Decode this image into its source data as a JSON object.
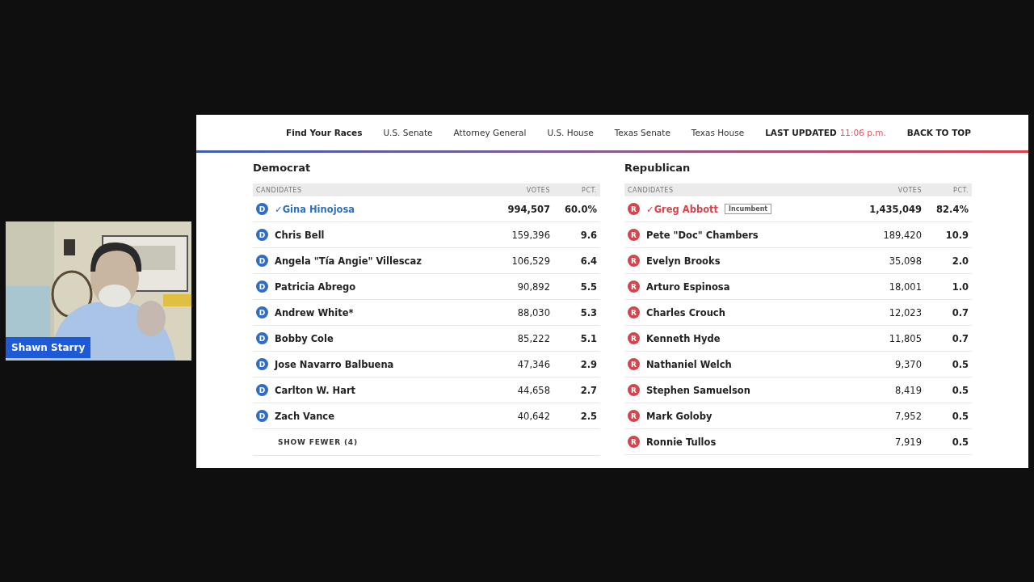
{
  "video_tile": {
    "participant": "Shawn Starry"
  },
  "shared_screen": {
    "nav": [
      {
        "kind": "bold",
        "label": "Find Your Races"
      },
      {
        "kind": "link",
        "label": "U.S. Senate"
      },
      {
        "kind": "link",
        "label": "Attorney General"
      },
      {
        "kind": "link",
        "label": "U.S. House"
      },
      {
        "kind": "link",
        "label": "Texas Senate"
      },
      {
        "kind": "link",
        "label": "Texas House"
      },
      {
        "kind": "updated",
        "label": "LAST UPDATED",
        "time": "11:06 p.m."
      },
      {
        "kind": "bold",
        "label": "BACK TO TOP"
      }
    ],
    "races": [
      {
        "party": "Democrat",
        "color": "#2e6ec2",
        "columns": [
          "CANDIDATES",
          "VOTES",
          "PCT."
        ],
        "candidates": [
          {
            "letter": "D",
            "name": "Gina Hinojosa",
            "winner": true,
            "check": "✓",
            "votes": "994,507",
            "pct": "60.0%"
          },
          {
            "letter": "D",
            "name": "Chris Bell",
            "winner": false,
            "votes": "159,396",
            "pct": "9.6"
          },
          {
            "letter": "D",
            "name": "Angela \"Tía Angie\" Villescaz",
            "winner": false,
            "votes": "106,529",
            "pct": "6.4"
          },
          {
            "letter": "D",
            "name": "Patricia Abrego",
            "winner": false,
            "votes": "90,892",
            "pct": "5.5"
          },
          {
            "letter": "D",
            "name": "Andrew White*",
            "winner": false,
            "votes": "88,030",
            "pct": "5.3"
          },
          {
            "letter": "D",
            "name": "Bobby Cole",
            "winner": false,
            "votes": "85,222",
            "pct": "5.1"
          },
          {
            "letter": "D",
            "name": "Jose Navarro Balbuena",
            "winner": false,
            "votes": "47,346",
            "pct": "2.9"
          },
          {
            "letter": "D",
            "name": "Carlton W. Hart",
            "winner": false,
            "votes": "44,658",
            "pct": "2.7"
          },
          {
            "letter": "D",
            "name": "Zach Vance",
            "winner": false,
            "votes": "40,642",
            "pct": "2.5"
          }
        ],
        "toggle": "SHOW FEWER (4)"
      },
      {
        "party": "Republican",
        "color": "#d8424a",
        "columns": [
          "CANDIDATES",
          "VOTES",
          "PCT."
        ],
        "candidates": [
          {
            "letter": "R",
            "name": "Greg Abbott",
            "winner": true,
            "check": "✓",
            "badge": "Incumbent",
            "votes": "1,435,049",
            "pct": "82.4%"
          },
          {
            "letter": "R",
            "name": "Pete \"Doc\" Chambers",
            "winner": false,
            "votes": "189,420",
            "pct": "10.9"
          },
          {
            "letter": "R",
            "name": "Evelyn Brooks",
            "winner": false,
            "votes": "35,098",
            "pct": "2.0"
          },
          {
            "letter": "R",
            "name": "Arturo Espinosa",
            "winner": false,
            "votes": "18,001",
            "pct": "1.0"
          },
          {
            "letter": "R",
            "name": "Charles Crouch",
            "winner": false,
            "votes": "12,023",
            "pct": "0.7"
          },
          {
            "letter": "R",
            "name": "Kenneth Hyde",
            "winner": false,
            "votes": "11,805",
            "pct": "0.7"
          },
          {
            "letter": "R",
            "name": "Nathaniel Welch",
            "winner": false,
            "votes": "9,370",
            "pct": "0.5"
          },
          {
            "letter": "R",
            "name": "Stephen Samuelson",
            "winner": false,
            "votes": "8,419",
            "pct": "0.5"
          },
          {
            "letter": "R",
            "name": "Mark Goloby",
            "winner": false,
            "votes": "7,952",
            "pct": "0.5"
          },
          {
            "letter": "R",
            "name": "Ronnie Tullos",
            "winner": false,
            "votes": "7,919",
            "pct": "0.5"
          }
        ]
      }
    ]
  }
}
